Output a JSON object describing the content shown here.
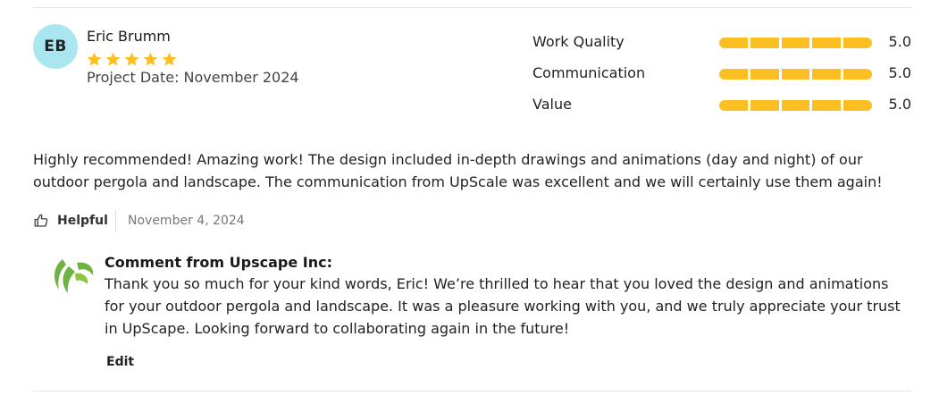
{
  "review": {
    "avatar_initials": "EB",
    "reviewer_name": "Eric Brumm",
    "star_rating": 5,
    "star_color": "#fbbf24",
    "project_date": "Project Date: November 2024",
    "ratings": [
      {
        "label": "Work Quality",
        "value": "5.0",
        "score": 5
      },
      {
        "label": "Communication",
        "value": "5.0",
        "score": 5
      },
      {
        "label": "Value",
        "value": "5.0",
        "score": 5
      }
    ],
    "body": "Highly recommended! Amazing work! The design included in-depth drawings and animations (day and night) of our outdoor pergola and landscape. The communication from UpScale was excellent and we will certainly use them again!",
    "helpful_label": "Helpful",
    "helpful_icon": "thumbs-up-icon",
    "date": "November 4, 2024"
  },
  "comment": {
    "logo_icon": "upscape-logo",
    "logo_color": "#6db33f",
    "title": "Comment from Upscape Inc:",
    "body": "Thank you so much for your kind words, Eric! We’re thrilled to hear that you loved the design and animations for your outdoor pergola and landscape. It was a pleasure working with you, and we truly appreciate your trust in UpScape. Looking forward to collaborating again in the future!",
    "edit_label": "Edit"
  }
}
